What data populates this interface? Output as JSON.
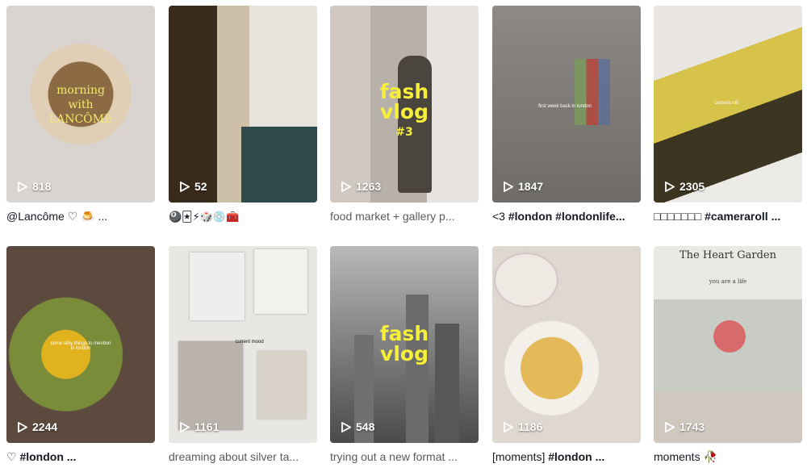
{
  "videos": [
    {
      "views": "818",
      "caption_a": "@Lancôme ",
      "caption_b": "♡ 🍮 ...",
      "overlay": [
        "morning",
        "with",
        "LANCÔME"
      ]
    },
    {
      "views": "52",
      "caption_a": "🎱🃏⚡🎲💿🧰",
      "caption_b": ""
    },
    {
      "views": "1263",
      "caption_a": "food market + gallery p...",
      "caption_b": "",
      "overlay": [
        "fash",
        "vlog",
        "#3"
      ]
    },
    {
      "views": "1847",
      "caption_a": "<3 ",
      "caption_b": "#london #londonlife...",
      "overlay_small": "first week back in london"
    },
    {
      "views": "2305",
      "caption_a": "□□□□□□□ ",
      "caption_b": "#cameraroll ...",
      "overlay_small": "camera roll"
    },
    {
      "views": "2244",
      "caption_a": "♡ ",
      "caption_b": "#london ...",
      "overlay_small": "some silliy things to mention in london"
    },
    {
      "views": "1161",
      "caption_a": "dreaming about silver ta...",
      "caption_b": "",
      "overlay_small": "current mood"
    },
    {
      "views": "548",
      "caption_a": "trying out a new format ...",
      "caption_b": "",
      "overlay": [
        "fash",
        "vlog"
      ]
    },
    {
      "views": "1186",
      "caption_a": "[moments] ",
      "caption_b": "#london ..."
    },
    {
      "views": "1743",
      "caption_a": "moments ",
      "caption_b": "🥀",
      "overlay_text": [
        "The Heart Garden",
        "you are a life"
      ]
    }
  ]
}
